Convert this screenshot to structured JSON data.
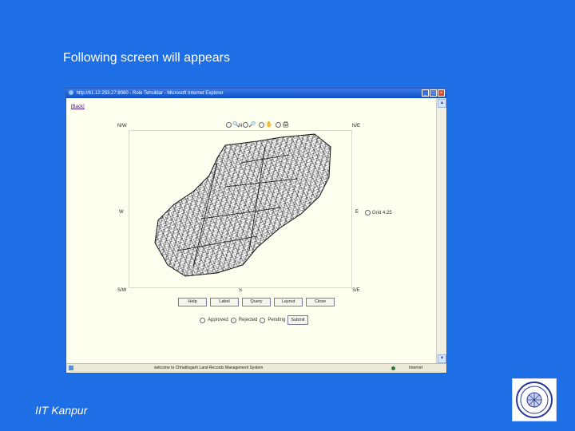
{
  "slide": {
    "heading": "Following screen will appears",
    "footer": "IIT Kanpur",
    "background_color": "#1e6ee6",
    "logo_icon": "iit-kanpur-seal-icon"
  },
  "browser": {
    "title": "http://61.12.253.27:8080 - Role Tehsildar - Microsoft Internet Explorer",
    "window_buttons": [
      "_",
      "□",
      "×"
    ],
    "back_link": "[Back]",
    "tools": [
      "zoom-in-icon",
      "zoom-out-icon",
      "pan-icon",
      "print-icon"
    ],
    "compass": {
      "nw": "N/W",
      "n": "N",
      "ne": "N/E",
      "w": "W",
      "e": "E",
      "sw": "S/W",
      "s": "S",
      "se": "S/E"
    },
    "grid_option": "Grid 4.25",
    "buttons": [
      "Help",
      "Label",
      "Query",
      "Layout",
      "Close"
    ],
    "status_options": [
      "Approved",
      "Rejected",
      "Pending"
    ],
    "submit_label": "Submit",
    "status_message": "welcome to Chhattisgarh Land Records Management System",
    "zone": "Internet"
  }
}
